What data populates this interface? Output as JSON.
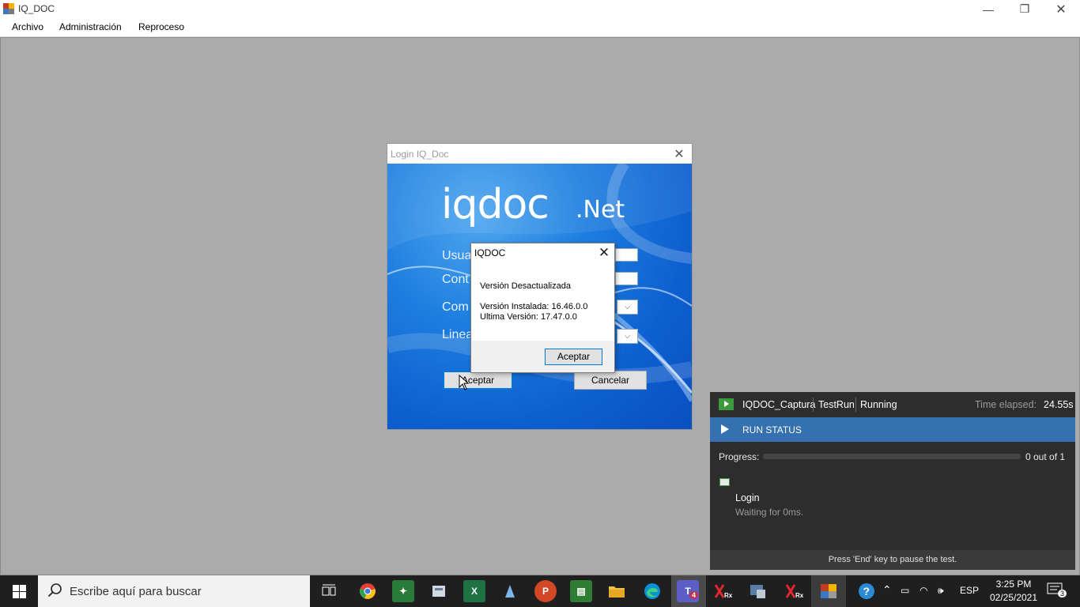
{
  "window": {
    "title": "IQ_DOC",
    "minimize": "—",
    "maximize": "❐",
    "close": "✕"
  },
  "menu": {
    "items": [
      "Archivo",
      "Administración",
      "Reproceso"
    ]
  },
  "login": {
    "title": "Login IQ_Doc",
    "logo_main": "iqdoc",
    "logo_suffix": ".Net",
    "labels": {
      "usuario": "Usuar",
      "contrasena": "Cont",
      "compania": "Com",
      "linea": "Linea"
    },
    "accept": "Aceptar",
    "cancel": "Cancelar",
    "close": "✕"
  },
  "msgbox": {
    "title": "IQDOC",
    "line1": "Versión Desactualizada",
    "line2": "Versión Instalada: 16.46.0.0",
    "line3": "Ultima Versión: 17.47.0.0",
    "accept": "Aceptar",
    "close": "✕"
  },
  "run_panel": {
    "project": "IQDOC_Captura",
    "testrun": "TestRun",
    "state": "Running",
    "elapsed_label": "Time elapsed:",
    "elapsed": "24.55s",
    "status_label": "RUN STATUS",
    "progress_label": "Progress:",
    "progress_fraction": 0,
    "progress_count": "0 out of 1",
    "step_name": "Login",
    "step_status": "Waiting for 0ms.",
    "footer": "Press 'End' key to pause the test."
  },
  "taskbar": {
    "search_placeholder": "Escribe aquí para buscar",
    "language": "ESP",
    "time": "3:25 PM",
    "date": "02/25/2021",
    "notifications": "3",
    "teams_badge": "4",
    "colors": {
      "chrome": "#e44134",
      "excel": "#1f7244",
      "powerpoint": "#d24726",
      "edge": "#0c8fd6",
      "teams": "#5b5fc7"
    }
  }
}
